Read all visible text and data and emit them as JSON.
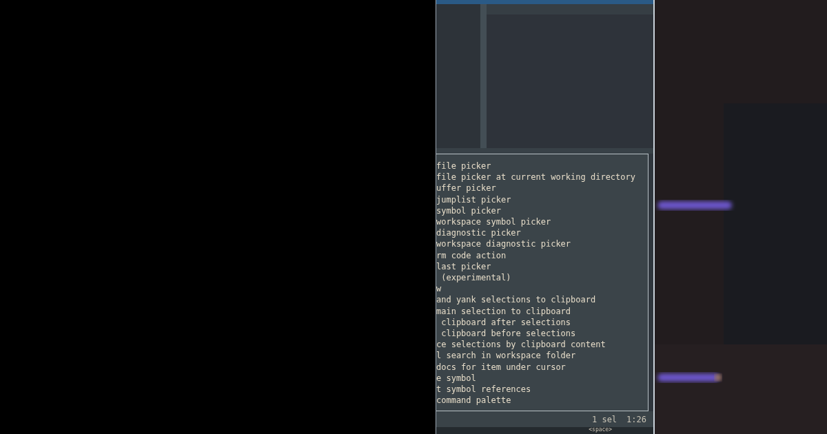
{
  "menu_lines": [
    "file picker",
    "file picker at current working directory",
    "uffer picker",
    "jumplist picker",
    "symbol picker",
    "workspace symbol picker",
    "diagnostic picker",
    "workspace diagnostic picker",
    "rm code action",
    "last picker",
    " (experimental)",
    "w",
    "and yank selections to clipboard",
    "main selection to clipboard",
    " clipboard after selections",
    " clipboard before selections",
    "ce selections by clipboard content",
    "l search in workspace folder",
    "docs for item under cursor",
    "e symbol",
    "t symbol references",
    "command palette"
  ],
  "status_bar": {
    "selections": "1 sel",
    "position": "1:26"
  },
  "key_hint": "<space>"
}
